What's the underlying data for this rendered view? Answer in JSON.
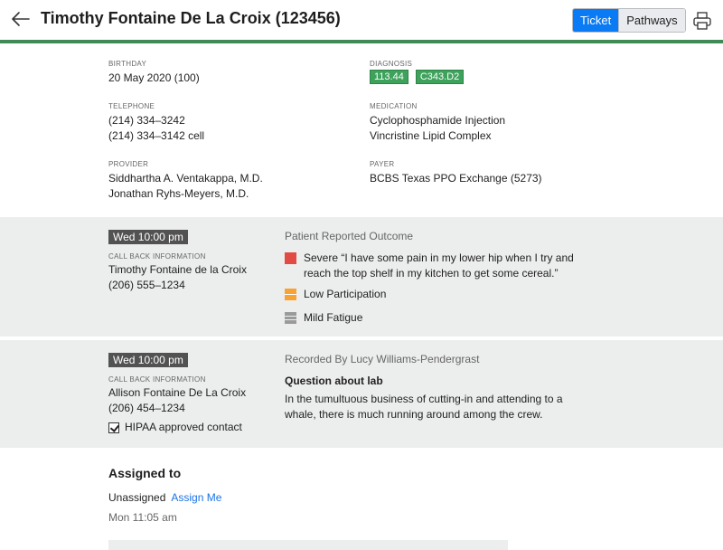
{
  "header": {
    "title": "Timothy Fontaine De La Croix (123456)",
    "tabs": [
      "Ticket",
      "Pathways"
    ],
    "active_tab": "Ticket",
    "accent_color": "#0a7bf5",
    "bar_color": "#3f8a55"
  },
  "patient": {
    "birthday_label": "BIRTHDAY",
    "birthday": "20 May 2020 (100)",
    "diagnosis_label": "DIAGNOSIS",
    "diagnosis_codes": [
      "113.44",
      "C343.D2"
    ],
    "telephone_label": "TELEPHONE",
    "telephones": [
      "(214) 334–3242",
      "(214) 334–3142 cell"
    ],
    "medication_label": "MEDICATION",
    "medications": [
      "Cyclophosphamide Injection",
      "Vincristine Lipid Complex"
    ],
    "provider_label": "PROVIDER",
    "providers": [
      "Siddhartha A. Ventakappa, M.D.",
      "Jonathan Ryhs-Meyers, M.D."
    ],
    "payer_label": "PAYER",
    "payer": "BCBS Texas PPO Exchange (5273)"
  },
  "entries": [
    {
      "time": "Wed 10:00 pm",
      "callback_label": "CALL BACK INFORMATION",
      "callback_name": "Timothy Fontaine de la Croix",
      "callback_phone": "(206) 555–1234",
      "heading": "Patient Reported Outcome",
      "outcomes": [
        {
          "severity": "red",
          "text": "Severe “I have some pain in my lower hip when I try and",
          "text2": "reach the top shelf in my kitchen to get some cereal.”"
        },
        {
          "severity": "orange",
          "text": "Low Participation"
        },
        {
          "severity": "gray",
          "text": "Mild Fatigue"
        }
      ]
    },
    {
      "time": "Wed 10:00 pm",
      "callback_label": "CALL BACK INFORMATION",
      "callback_name": "Allison Fontaine De La Croix",
      "callback_phone": "(206) 454–1234",
      "hipaa_label": "HIPAA approved contact",
      "hipaa_checked": true,
      "heading": "Recorded By Lucy Williams-Pendergrast",
      "subject": "Question about lab",
      "body_line1": "In the tumultuous business of cutting-in and attending to a",
      "body_line2": "whale, there is much running around among the crew."
    }
  ],
  "assignment": {
    "title": "Assigned to",
    "status": "Unassigned",
    "action": "Assign Me",
    "time": "Mon 11:05 am"
  },
  "icons": {
    "back": "arrow-left-icon",
    "print": "printer-icon",
    "severity_colors": {
      "red": "#e24b43",
      "orange": "#f8a234",
      "gray": "#9a9a9a"
    }
  }
}
